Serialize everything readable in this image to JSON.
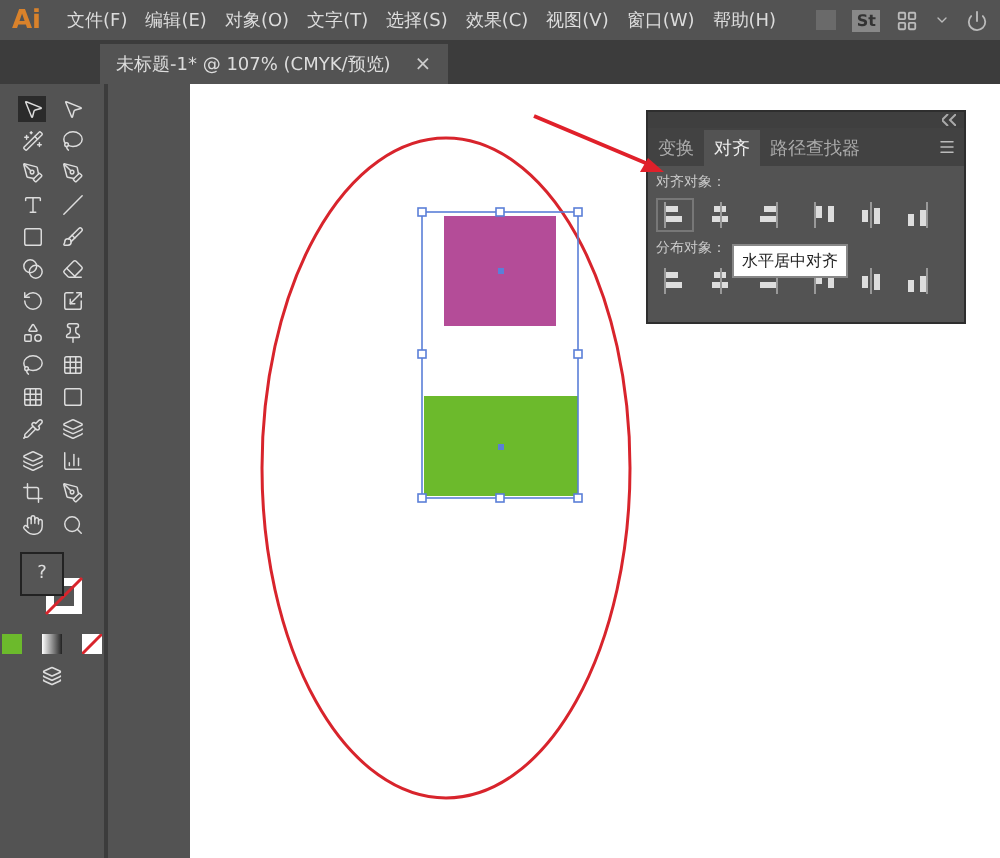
{
  "app": {
    "logo": "Ai"
  },
  "menu": [
    "文件(F)",
    "编辑(E)",
    "对象(O)",
    "文字(T)",
    "选择(S)",
    "效果(C)",
    "视图(V)",
    "窗口(W)",
    "帮助(H)"
  ],
  "toolbar_right": {
    "stock": "St"
  },
  "document_tab": {
    "title": "未标题-1* @ 107% (CMYK/预览)",
    "close": "×"
  },
  "tools": {
    "fill_stroke_help": "?"
  },
  "panel": {
    "tabs": [
      {
        "label": "变换",
        "selected": false
      },
      {
        "label": "对齐",
        "selected": true
      },
      {
        "label": "路径查找器",
        "selected": false
      }
    ],
    "align_label": "对齐对象：",
    "distribute_label": "分布对象：",
    "tooltip": "水平居中对齐"
  },
  "canvas": {
    "shapes": [
      {
        "kind": "ellipse",
        "color": "#d8242c"
      },
      {
        "kind": "square",
        "color": "#b44c98"
      },
      {
        "kind": "rectangle",
        "color": "#6cba2c"
      }
    ]
  }
}
